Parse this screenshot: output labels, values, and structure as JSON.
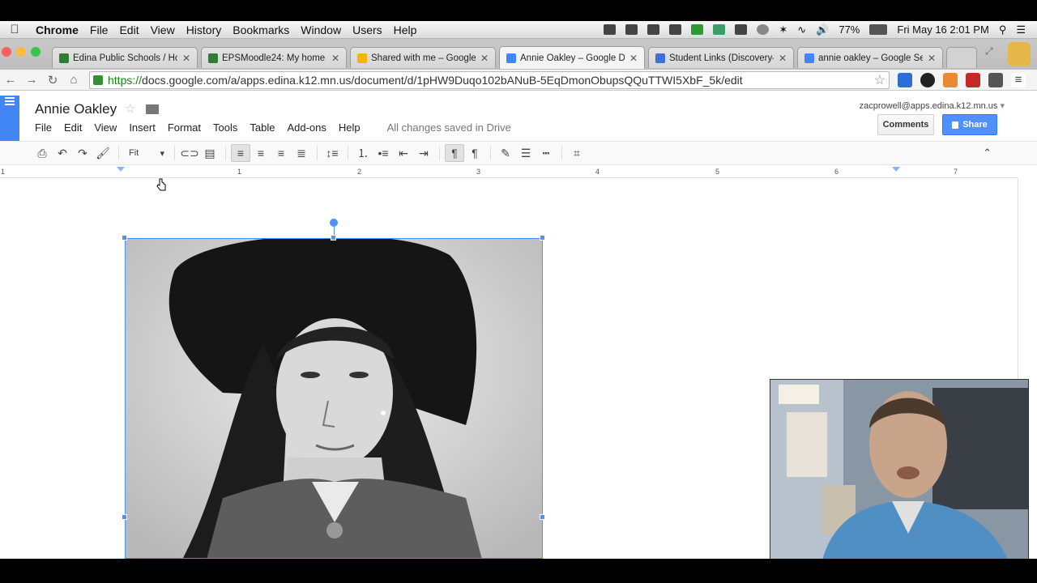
{
  "menubar": {
    "app": "Chrome",
    "items": [
      "File",
      "Edit",
      "View",
      "History",
      "Bookmarks",
      "Window",
      "Users",
      "Help"
    ],
    "battery": "77%",
    "datetime": "Fri May 16  2:01 PM"
  },
  "tabs": [
    {
      "title": "Edina Public Schools / Ho",
      "color": "#2e7d32"
    },
    {
      "title": "EPSMoodle24: My home",
      "color": "#2e7d32"
    },
    {
      "title": "Shared with me – Google D",
      "color": "#f4b400"
    },
    {
      "title": "Annie Oakley – Google Do",
      "color": "#4285f4"
    },
    {
      "title": "Student Links (Discovery–",
      "color": "#3f6fd8"
    },
    {
      "title": "annie oakley – Google Sea",
      "color": "#4285f4"
    }
  ],
  "address": {
    "scheme": "https://",
    "rest": "docs.google.com/a/apps.edina.k12.mn.us/document/d/1pHW9Duqo102bANuB-5EqDmonObupsQQuTTWI5XbF_5k/edit"
  },
  "doc": {
    "title": "Annie Oakley",
    "menus": [
      "File",
      "Edit",
      "View",
      "Insert",
      "Format",
      "Tools",
      "Table",
      "Add-ons",
      "Help"
    ],
    "saved_status": "All changes saved in Drive",
    "user_email": "zacprowell@apps.edina.k12.mn.us",
    "comments_label": "Comments",
    "share_label": "Share",
    "zoom_label": "Fit"
  },
  "ruler": {
    "labels": [
      "1",
      "1",
      "2",
      "3",
      "4",
      "5",
      "6",
      "7"
    ]
  },
  "icons": {
    "print": "print-icon",
    "undo": "undo-icon",
    "redo": "redo-icon",
    "paint": "paint-format-icon",
    "link": "link-icon",
    "comment": "comment-icon",
    "align_left": "align-left-icon",
    "align_center": "align-center-icon",
    "align_right": "align-right-icon",
    "justify": "justify-icon",
    "line_spacing": "line-spacing-icon",
    "numbered": "numbered-list-icon",
    "bulleted": "bulleted-list-icon",
    "dec_indent": "decrease-indent-icon",
    "inc_indent": "increase-indent-icon",
    "ltr": "ltr-icon",
    "rtl": "rtl-icon",
    "pen": "pen-icon",
    "line_weight": "line-weight-icon",
    "line_dash": "line-dash-icon",
    "crop": "crop-icon"
  }
}
